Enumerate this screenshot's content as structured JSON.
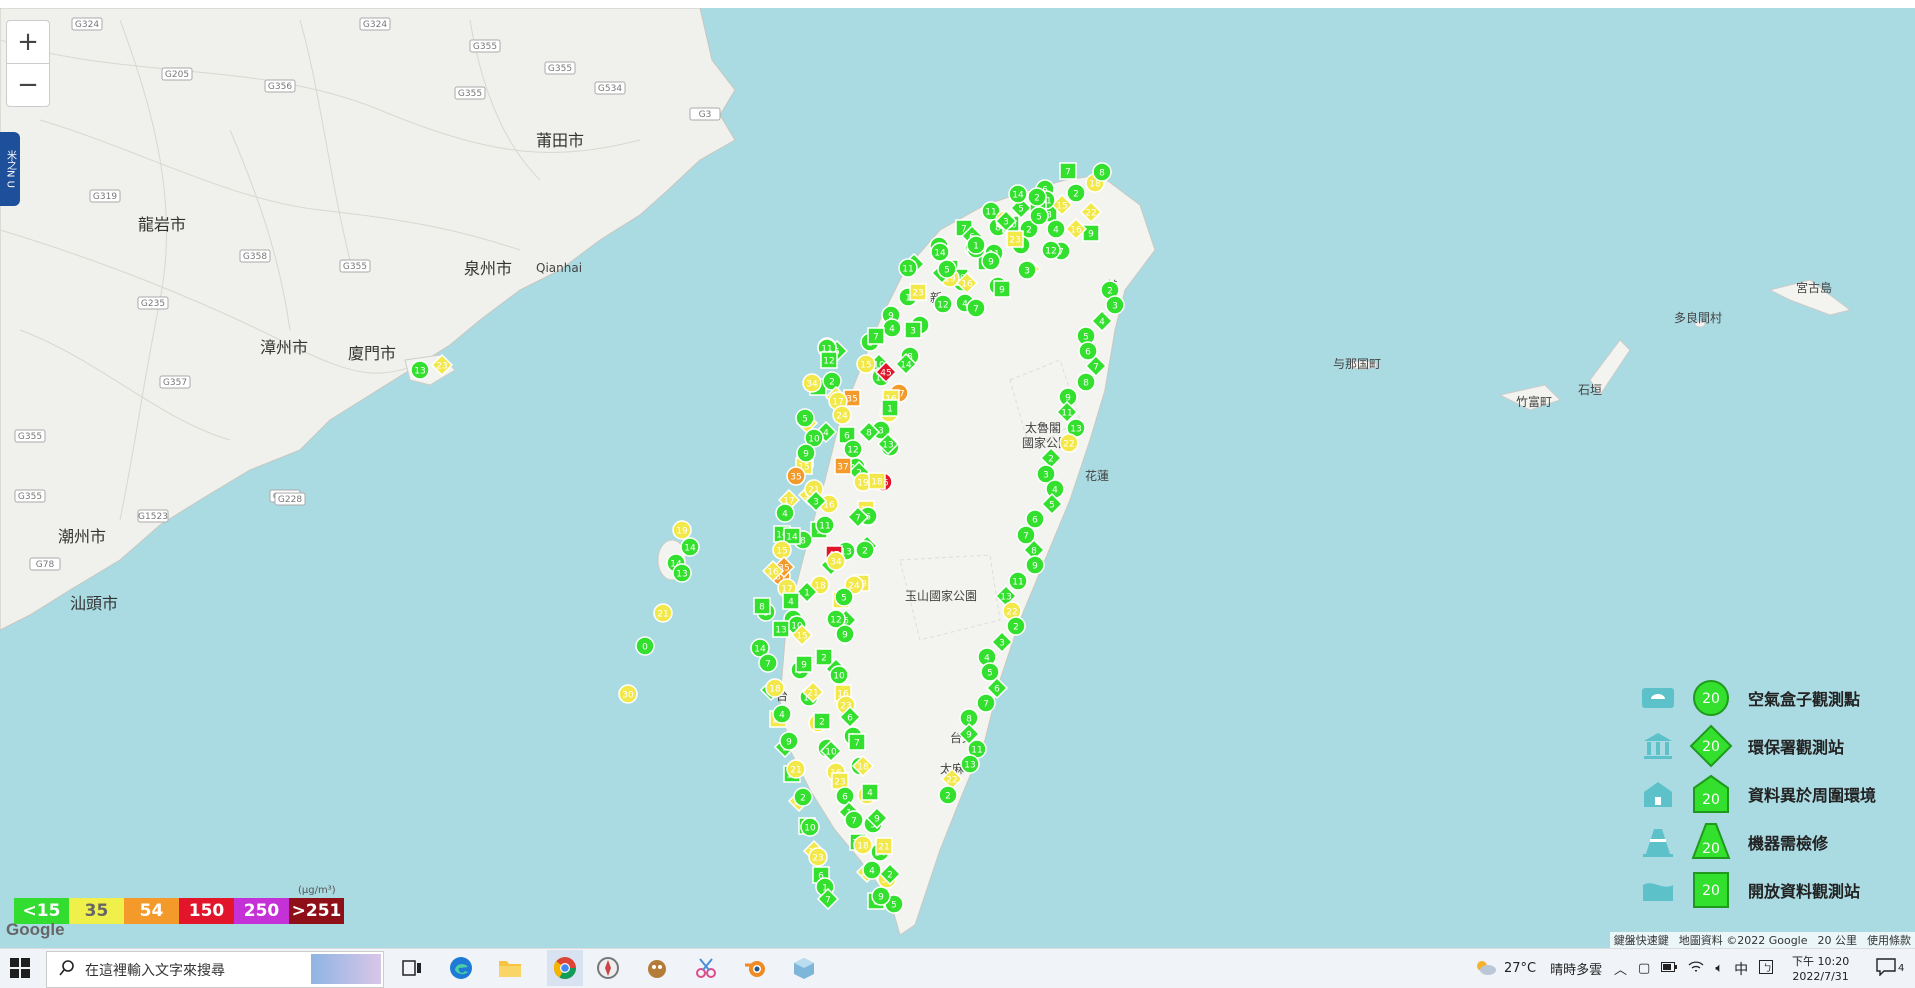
{
  "map": {
    "labels": {
      "putian": "莆田市",
      "longyan": "龍岩市",
      "quanzhou": "泉州市",
      "qianhai": "Qianhai",
      "zhangzhou": "漳州市",
      "xiamen": "廈門市",
      "chaozhou": "潮州市",
      "shantou": "汕頭市",
      "yonaguni": "与那国町",
      "taketomi": "竹富町",
      "ishigaki": "石垣",
      "tarama": "多良間村",
      "miyakojima": "宮古島",
      "taroko": "太魯閣",
      "taroko2": "國家公園",
      "yushan": "玉山國家公園",
      "taitung": "台東",
      "taimali": "太麻",
      "hualien": "花蓮",
      "hsinchu": "新",
      "kaohsiung": "高",
      "tainan": "台",
      "jilong": "基"
    },
    "roads": [
      "G324",
      "G324",
      "G355",
      "G534",
      "G205",
      "G356",
      "G355",
      "G358",
      "G355",
      "G235",
      "G319",
      "G357",
      "G355",
      "G358",
      "G1523",
      "G228",
      "G355",
      "G78",
      "G355",
      "G3"
    ]
  },
  "sensors": {
    "values_north": [
      "3",
      "2",
      "6",
      "9",
      "8",
      "4",
      "1",
      "5",
      "7",
      "10",
      "11",
      "12",
      "15",
      "19",
      "23",
      "2",
      "4",
      "3",
      "6",
      "9",
      "11",
      "14",
      "16",
      "18",
      "3",
      "5",
      "8",
      "22",
      "2",
      "7"
    ],
    "values_west": [
      "1",
      "3",
      "4",
      "5",
      "6",
      "7",
      "8",
      "10",
      "11",
      "12",
      "13",
      "14",
      "15",
      "9",
      "2",
      "45",
      "37",
      "35",
      "34",
      "19",
      "18",
      "16",
      "17",
      "21",
      "24"
    ],
    "values_south": [
      "3",
      "5",
      "7",
      "9",
      "10",
      "12",
      "14",
      "16",
      "18",
      "21",
      "23",
      "28",
      "30",
      "6",
      "4",
      "2",
      "1"
    ],
    "values_east": [
      "2",
      "3",
      "4",
      "5",
      "6",
      "7",
      "8",
      "9",
      "11",
      "13",
      "22"
    ],
    "offshore": [
      "13",
      "23",
      "19",
      "14",
      "14",
      "21",
      "0",
      "30",
      "13"
    ]
  },
  "legend": {
    "items": [
      {
        "label": "空氣盒子觀測點",
        "value": "20",
        "shape": "circle"
      },
      {
        "label": "環保署觀測站",
        "value": "20",
        "shape": "diamond"
      },
      {
        "label": "資料異於周圍環境",
        "value": "20",
        "shape": "house"
      },
      {
        "label": "機器需檢修",
        "value": "20",
        "shape": "cone"
      },
      {
        "label": "開放資料觀測站",
        "value": "20",
        "shape": "square"
      }
    ]
  },
  "scale": {
    "unit": "(μg/m³)",
    "cells": [
      {
        "label": "<15",
        "color": "#33dd2f"
      },
      {
        "label": "35",
        "color": "#f0f04a"
      },
      {
        "label": "54",
        "color": "#f39a2a"
      },
      {
        "label": "150",
        "color": "#e2152a"
      },
      {
        "label": "250",
        "color": "#c431d6"
      },
      {
        "label": ">251",
        "color": "#8e0f18"
      }
    ]
  },
  "controls": {
    "zoom_in": "+",
    "zoom_out": "−",
    "side_tab": "米之N U"
  },
  "attribution": {
    "google": "Google",
    "shortcuts": "鍵盤快速鍵",
    "mapdata": "地圖資料 ©2022 Google",
    "scale": "20 公里",
    "terms": "使用條款"
  },
  "taskbar": {
    "search_placeholder": "在這裡輸入文字來搜尋",
    "weather_temp": "27°C",
    "weather_desc": "晴時多雲",
    "ime": "中",
    "time": "下午 10:20",
    "date": "2022/7/31",
    "notifications": "4"
  },
  "colors": {
    "green": "#33e02e",
    "yellow": "#f3e84a",
    "orange": "#f39a2a",
    "red": "#e2152a",
    "sea": "#aadae2",
    "land": "#f2f2ef"
  }
}
